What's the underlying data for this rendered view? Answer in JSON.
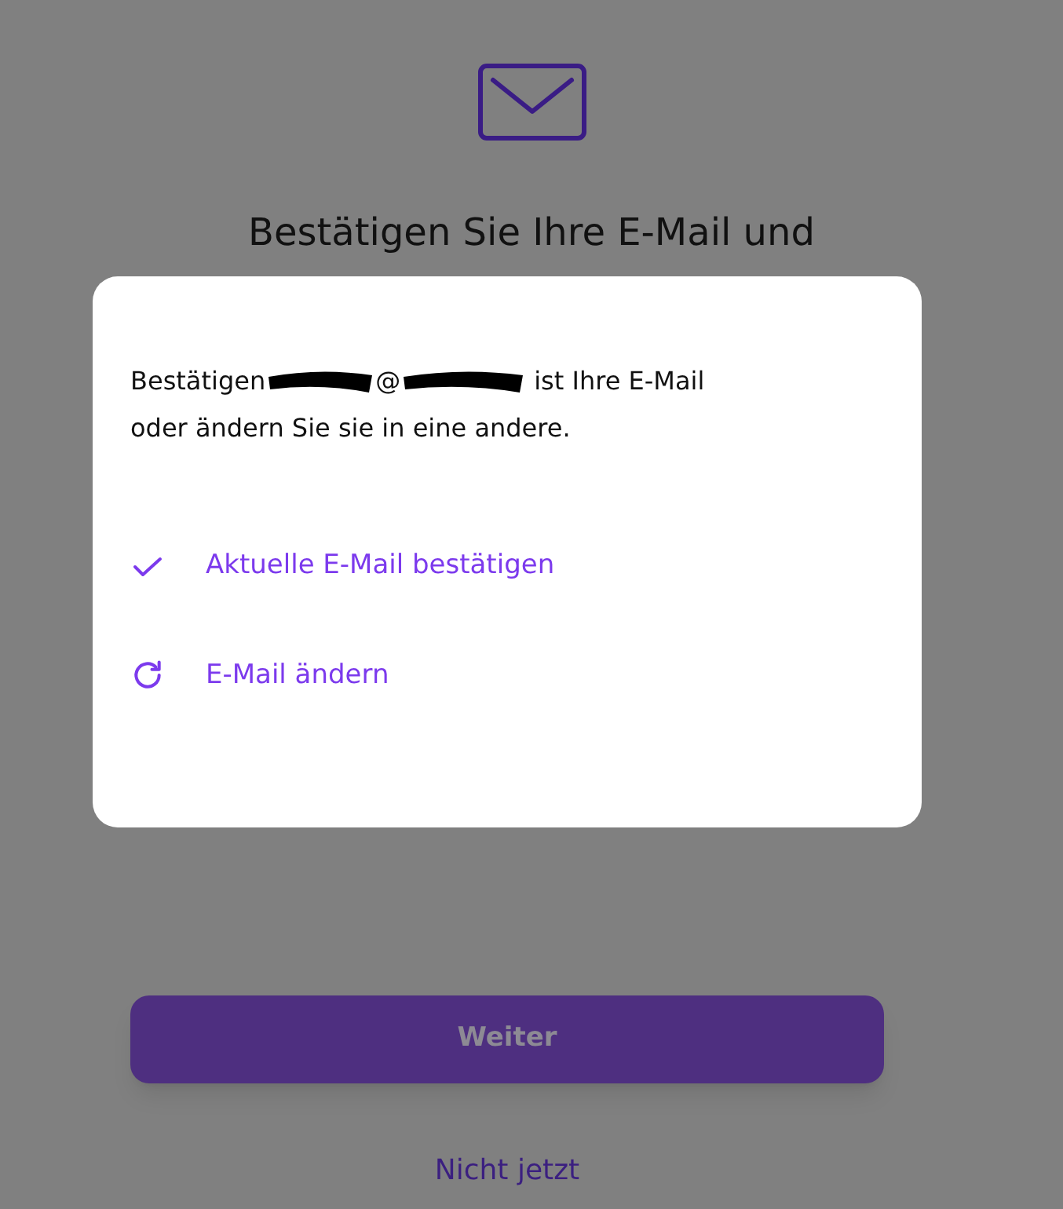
{
  "page": {
    "heading": "Bestätigen Sie Ihre E-Mail und",
    "primary_button": "Weiter",
    "secondary_link": "Nicht jetzt"
  },
  "dialog": {
    "message": {
      "before": "Bestätigen",
      "middle": "@",
      "after": "ist Ihre E-Mail",
      "second_line": "oder ändern Sie sie in eine andere."
    },
    "options": [
      {
        "kind": "confirm",
        "label": "Aktuelle E-Mail bestätigen"
      },
      {
        "kind": "change",
        "label": "E-Mail ändern"
      }
    ]
  }
}
